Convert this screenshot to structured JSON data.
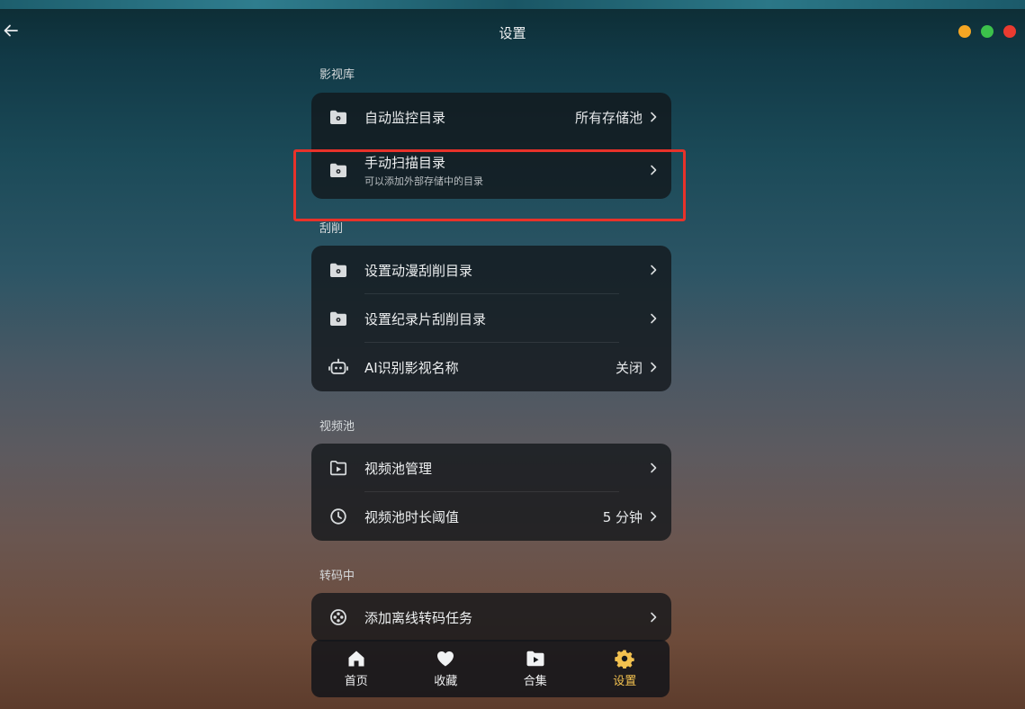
{
  "window": {
    "title": "设置",
    "controls": {
      "colors": [
        "#f5a623",
        "#3cc14b",
        "#ea3b30"
      ]
    }
  },
  "sections": [
    {
      "label": "影视库",
      "items": [
        {
          "icon": "folder-gear-icon",
          "label": "自动监控目录",
          "value": "所有存储池"
        },
        {
          "icon": "folder-gear-icon",
          "label": "手动扫描目录",
          "subtitle": "可以添加外部存储中的目录"
        }
      ]
    },
    {
      "label": "刮削",
      "items": [
        {
          "icon": "folder-gear-icon",
          "label": "设置动漫刮削目录"
        },
        {
          "icon": "folder-gear-icon",
          "label": "设置纪录片刮削目录"
        },
        {
          "icon": "robot-icon",
          "label": "AI识别影视名称",
          "value": "关闭"
        }
      ]
    },
    {
      "label": "视频池",
      "items": [
        {
          "icon": "play-folder-icon",
          "label": "视频池管理"
        },
        {
          "icon": "clock-icon",
          "label": "视频池时长阈值",
          "value": "5 分钟"
        }
      ]
    },
    {
      "label": "转码中",
      "items": [
        {
          "icon": "film-reel-icon",
          "label": "添加离线转码任务"
        }
      ]
    }
  ],
  "bottom_nav": {
    "items": [
      {
        "icon": "home-icon",
        "label": "首页"
      },
      {
        "icon": "heart-icon",
        "label": "收藏"
      },
      {
        "icon": "collection-icon",
        "label": "合集"
      },
      {
        "icon": "gear-icon",
        "label": "设置",
        "active": true
      }
    ],
    "active_color": "#f2c14f"
  },
  "highlight_color": "#e8322a"
}
